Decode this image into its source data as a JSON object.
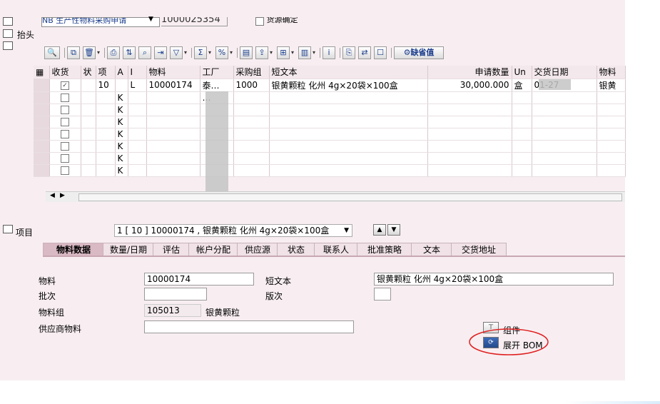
{
  "header": {
    "doc_type": "NB 生产性物料采购申请",
    "doc_number": "1000025354",
    "source_determination": "货源确定",
    "header_label": "抬头"
  },
  "toolbar": {
    "default_values_label": "缺省值"
  },
  "grid": {
    "columns": [
      "收货",
      "状",
      "项",
      "A",
      "I",
      "物料",
      "工厂",
      "采购组",
      "短文本",
      "申请数量",
      "Un",
      "交货日期",
      "物料"
    ],
    "rows": [
      {
        "checked": true,
        "item": "10",
        "a": "",
        "i": "L",
        "material": "10000174",
        "plant": "泰…",
        "group": "1000",
        "text": "银黄颗粒 化州 4g×20袋×100盒",
        "qty": "30,000.000",
        "unit": "盒",
        "date": "01-27",
        "matgroup": "银黄"
      },
      {
        "checked": false,
        "item": "",
        "a": "K",
        "i": "",
        "material": "",
        "plant": "…",
        "group": "",
        "text": "",
        "qty": "",
        "unit": "",
        "date": "",
        "matgroup": ""
      },
      {
        "checked": false,
        "item": "",
        "a": "K",
        "i": "",
        "material": "",
        "plant": "",
        "group": "",
        "text": "",
        "qty": "",
        "unit": "",
        "date": "",
        "matgroup": ""
      },
      {
        "checked": false,
        "item": "",
        "a": "K",
        "i": "",
        "material": "",
        "plant": "",
        "group": "",
        "text": "",
        "qty": "",
        "unit": "",
        "date": "",
        "matgroup": ""
      },
      {
        "checked": false,
        "item": "",
        "a": "K",
        "i": "",
        "material": "",
        "plant": "",
        "group": "",
        "text": "",
        "qty": "",
        "unit": "",
        "date": "",
        "matgroup": ""
      },
      {
        "checked": false,
        "item": "",
        "a": "K",
        "i": "",
        "material": "",
        "plant": "",
        "group": "",
        "text": "",
        "qty": "",
        "unit": "",
        "date": "",
        "matgroup": ""
      },
      {
        "checked": false,
        "item": "",
        "a": "K",
        "i": "",
        "material": "",
        "plant": "",
        "group": "",
        "text": "",
        "qty": "",
        "unit": "",
        "date": "",
        "matgroup": ""
      },
      {
        "checked": false,
        "item": "",
        "a": "K",
        "i": "",
        "material": "",
        "plant": "",
        "group": "",
        "text": "",
        "qty": "",
        "unit": "",
        "date": "",
        "matgroup": ""
      }
    ]
  },
  "item_section": {
    "label": "项目",
    "selected_item": "1 [ 10 ] 10000174 , 银黄颗粒 化州 4g×20袋×100盒"
  },
  "tabs": [
    "物料数据",
    "数量/日期",
    "评估",
    "帐户分配",
    "供应源",
    "状态",
    "联系人",
    "批准策略",
    "文本",
    "交货地址"
  ],
  "form": {
    "material_label": "物料",
    "material_value": "10000174",
    "short_text_label": "短文本",
    "short_text_value": "银黄颗粒 化州 4g×20袋×100盒",
    "batch_label": "批次",
    "batch_value": "",
    "revision_label": "版次",
    "revision_value": "",
    "matgroup_label": "物料组",
    "matgroup_value": "105013",
    "matgroup_desc": "银黄颗粒",
    "vendor_material_label": "供应商物料",
    "vendor_material_value": "",
    "components_label": "组件",
    "explode_bom_label": "展开 BOM"
  },
  "colors": {
    "background": "#f8eef1",
    "active_tab": "#d9b9c4",
    "annotation_circle": "#e02020"
  }
}
